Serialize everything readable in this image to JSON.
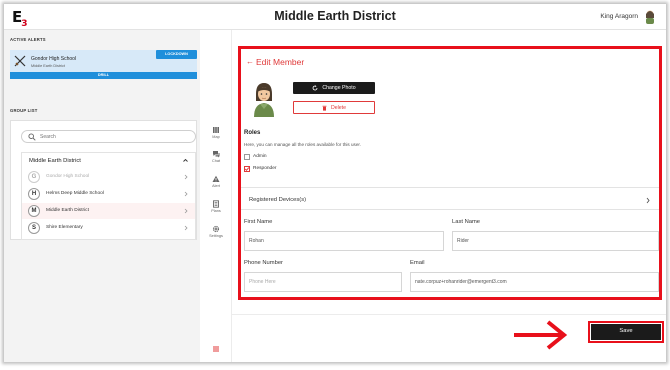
{
  "app": {
    "logo_text": "E",
    "logo_sub": "3",
    "title": "Middle Earth District",
    "user_name": "King Aragorn"
  },
  "colors": {
    "accent_red": "#e8101b",
    "alert_blue": "#1f8fdb",
    "alert_bg": "#d7e9f8",
    "dark_button": "#1b1b1b"
  },
  "left_panel": {
    "active_alerts_label": "ACTIVE ALERTS",
    "alert": {
      "school": "Gondor High School",
      "district": "Middle Earth District",
      "lockdown_label": "LOCKDOWN",
      "drill_label": "DRILL",
      "icon": "swords-icon"
    },
    "group_list_label": "GROUP LIST",
    "search_placeholder": "Search",
    "district": {
      "name": "Middle Earth District",
      "items": [
        {
          "letter": "G",
          "label": "Gondor High School",
          "dimmed": true
        },
        {
          "letter": "H",
          "label": "Helms Deep Middle School",
          "dimmed": false
        },
        {
          "letter": "M",
          "label": "Middle Earth District",
          "dimmed": false,
          "active": true
        },
        {
          "letter": "S",
          "label": "Shire Elementary",
          "dimmed": false
        }
      ]
    }
  },
  "rail": {
    "items": [
      {
        "label": "Map",
        "icon": "map-icon"
      },
      {
        "label": "Chat",
        "icon": "chat-icon"
      },
      {
        "label": "Alert",
        "icon": "alert-icon"
      },
      {
        "label": "Plans",
        "icon": "plans-icon"
      },
      {
        "label": "Settings",
        "icon": "gear-icon"
      }
    ],
    "menu_icon": "hamburger-icon"
  },
  "edit": {
    "back_arrow": "←",
    "title": "Edit Member",
    "change_photo_label": "Change Photo",
    "delete_label": "Delete",
    "roles_title": "Roles",
    "roles_desc": "Here, you can manage all the roles available for this user.",
    "roles": [
      {
        "label": "Admin",
        "checked": false
      },
      {
        "label": "Responder",
        "checked": true
      }
    ],
    "registered_devices_label": "Registered Devices(s)",
    "first_name_label": "First Name",
    "first_name_value": "Rohan",
    "last_name_label": "Last Name",
    "last_name_value": "Rider",
    "phone_label": "Phone Number",
    "phone_placeholder": "Phone Here",
    "phone_value": "",
    "email_label": "Email",
    "email_value": "nate.corpuz+rohanrider@emergent3.com"
  },
  "save_label": "Save"
}
